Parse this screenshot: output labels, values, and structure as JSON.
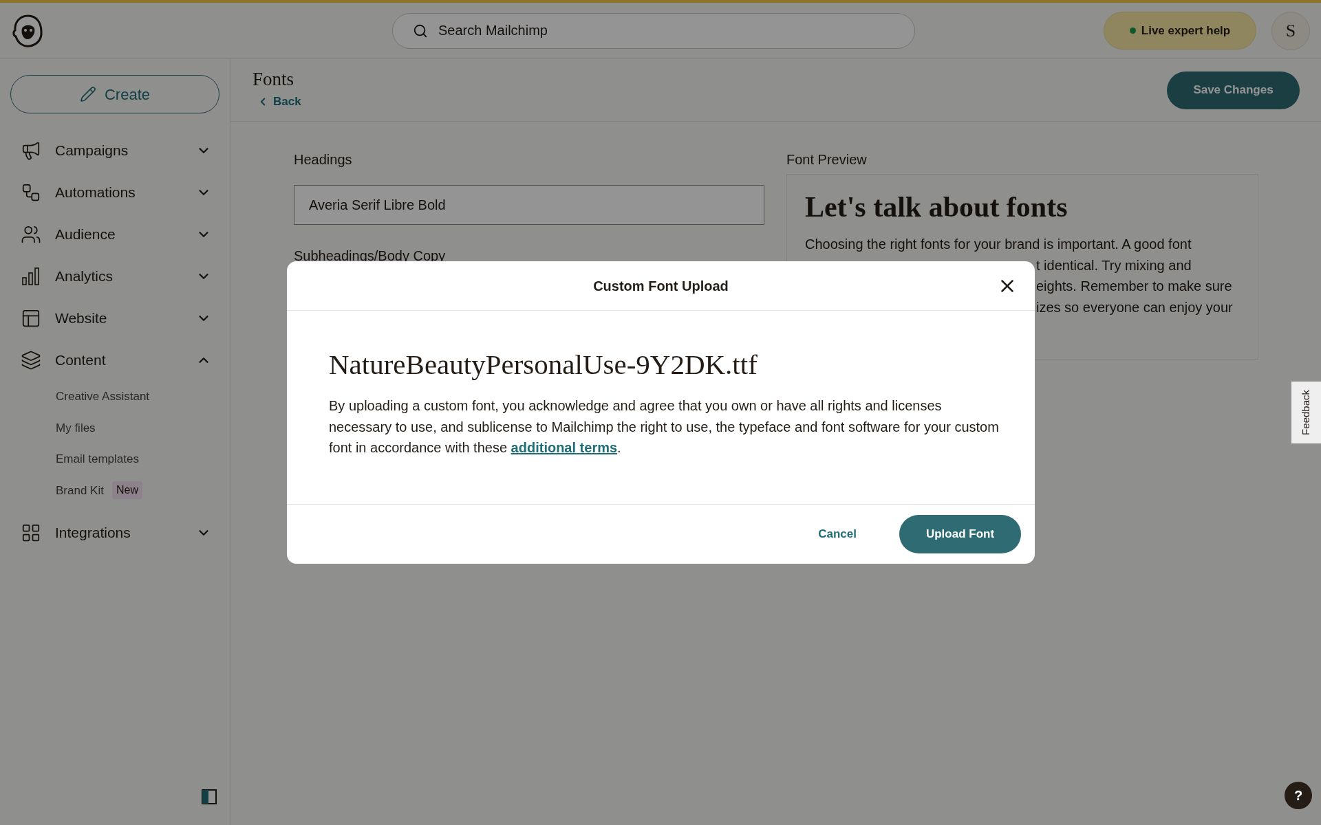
{
  "top_bar": {
    "search": {
      "placeholder": "Search Mailchimp"
    },
    "help_button": "Live expert help",
    "avatar": "S"
  },
  "sidebar": {
    "create_button": "Create",
    "items": [
      {
        "label": "Campaigns",
        "expanded": false
      },
      {
        "label": "Automations",
        "expanded": false
      },
      {
        "label": "Audience",
        "expanded": false
      },
      {
        "label": "Analytics",
        "expanded": false
      },
      {
        "label": "Website",
        "expanded": false
      },
      {
        "label": "Content",
        "expanded": true,
        "children": [
          {
            "label": "Creative Assistant"
          },
          {
            "label": "My files"
          },
          {
            "label": "Email templates"
          },
          {
            "label": "Brand Kit",
            "badge": "New"
          }
        ]
      },
      {
        "label": "Integrations",
        "expanded": false
      }
    ]
  },
  "page": {
    "title": "Fonts",
    "back": "Back",
    "save_button": "Save Changes",
    "headings_label": "Headings",
    "headings_value": "Averia Serif Libre Bold",
    "subheadings_label": "Subheadings/Body Copy",
    "preview": {
      "label": "Font Preview",
      "heading": "Let's talk about fonts",
      "lines": [
        "Choosing the right fonts for your brand is important. A good font",
        "t identical. Try mixing and",
        "eights. Remember to make sure",
        "izes so everyone can enjoy your"
      ]
    }
  },
  "modal": {
    "title": "Custom Font Upload",
    "filename": "NatureBeautyPersonalUse-9Y2DK.ttf",
    "body_before": "By uploading a custom font, you acknowledge and agree that you own or have all rights and licenses necessary to use, and sublicense to Mailchimp the right to use, the typeface and font software for your custom font in accordance with these ",
    "link": "additional terms",
    "body_after": ".",
    "cancel": "Cancel",
    "confirm": "Upload Font"
  },
  "feedback_tab": "Feedback",
  "help_button": "?"
}
